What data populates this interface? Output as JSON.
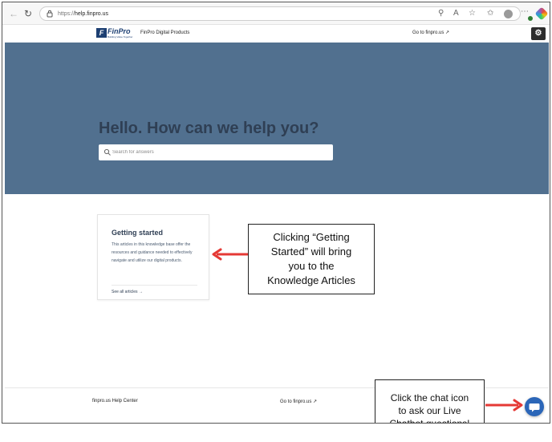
{
  "browser": {
    "url_protocol": "https://",
    "url_host": "help.finpro.us",
    "icons": [
      "back-icon",
      "refresh-icon",
      "lock-icon",
      "zoom-icon",
      "read-aloud-icon",
      "favorite-icon",
      "favorites-icon",
      "profile-icon",
      "more-icon",
      "copilot-icon"
    ]
  },
  "header": {
    "logo_word": "FinPro",
    "logo_tagline": "Building Value Together",
    "title": "FinPro Digital Products",
    "site_link": "Go to finpro.us",
    "hubspot_icon": "hubspot-icon"
  },
  "hero": {
    "title": "Hello. How can we help you?",
    "search_placeholder": "Search for answers",
    "search_value": ""
  },
  "card": {
    "title": "Getting started",
    "description": "This articles in this knowledge base offer the resources and guidance needed to effectively navigate and utilize our digital products.",
    "link": "See all articles"
  },
  "callouts": {
    "getting_started": "Clicking “Getting\nStarted” will bring\nyou to the\nKnowledge Articles",
    "chat": "Click the chat icon\nto ask our Live\nChatbot questions!"
  },
  "footer": {
    "left": "finpro.us Help Center",
    "link": "Go to finpro.us"
  },
  "colors": {
    "hero_bg": "#51708f",
    "hero_text": "#2f3f54",
    "brand": "#1d3f72",
    "chat_button": "#2b66b8",
    "arrow": "#e53935"
  }
}
